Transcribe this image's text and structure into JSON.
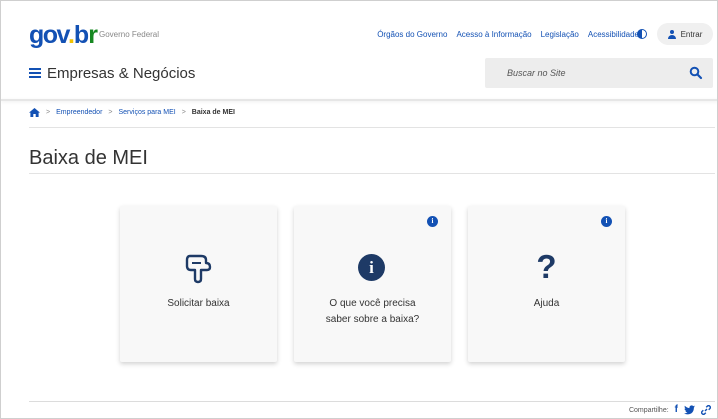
{
  "header": {
    "logo": {
      "part1": "gov",
      "dot": ".",
      "part2": "b",
      "part3": "r"
    },
    "gov_label": "Governo Federal",
    "top_links": [
      "Órgãos do Governo",
      "Acesso à Informação",
      "Legislação",
      "Acessibilidade"
    ],
    "login_label": "Entrar",
    "site_title": "Empresas & Negócios",
    "search": {
      "placeholder": "Buscar no Site",
      "value": ""
    }
  },
  "breadcrumb": {
    "items": [
      "Empreendedor",
      "Serviços para MEI"
    ],
    "current": "Baixa de MEI",
    "separator": ">"
  },
  "page": {
    "title": "Baixa de MEI"
  },
  "cards": [
    {
      "label": "Solicitar baixa",
      "icon": "hand-pointing-icon",
      "has_info": false
    },
    {
      "label_line1": "O que você precisa",
      "label_line2": "saber sobre a baixa?",
      "icon": "info-icon",
      "has_info": true,
      "info_glyph": "i"
    },
    {
      "label": "Ajuda",
      "icon": "question-icon",
      "icon_glyph": "?",
      "has_info": true,
      "info_glyph": "i"
    }
  ],
  "footer": {
    "share_label": "Compartilhe:",
    "share_icons": [
      "facebook-icon",
      "twitter-icon",
      "link-icon"
    ],
    "share_glyphs": {
      "facebook": "f"
    }
  },
  "colors": {
    "primary": "#1351b4",
    "dark_icon": "#1e3a66",
    "logo_yellow": "#f2c200",
    "logo_green": "#168821"
  }
}
